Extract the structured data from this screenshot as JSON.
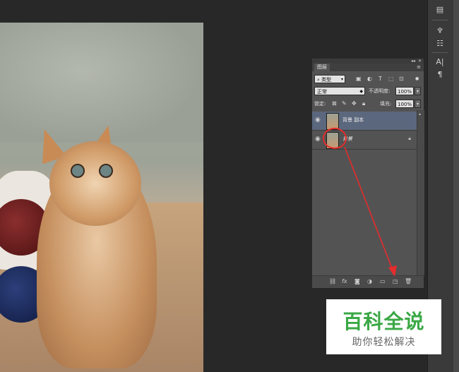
{
  "panel": {
    "tab": "图层",
    "filter_kind": "类型",
    "blend_mode": "正常",
    "opacity_label": "不透明度:",
    "opacity_value": "100%",
    "lock_label": "锁定:",
    "fill_label": "填充:",
    "fill_value": "100%",
    "layers": [
      {
        "name": "背景 副本",
        "selected": true,
        "locked": false,
        "visible": true
      },
      {
        "name": "背景",
        "selected": false,
        "locked": true,
        "visible": true
      }
    ]
  },
  "watermark": {
    "title": "百科全说",
    "subtitle": "助你轻松解决"
  },
  "colors": {
    "panel_bg": "#535353",
    "selected_layer": "#5b677d",
    "annotation_red": "#e62b2b",
    "logo_green": "#3aa845"
  },
  "icons": {
    "layer_visibility": "eye-icon",
    "lock": "lock-icon",
    "new_layer": "new-layer-icon",
    "delete": "trash-icon"
  }
}
